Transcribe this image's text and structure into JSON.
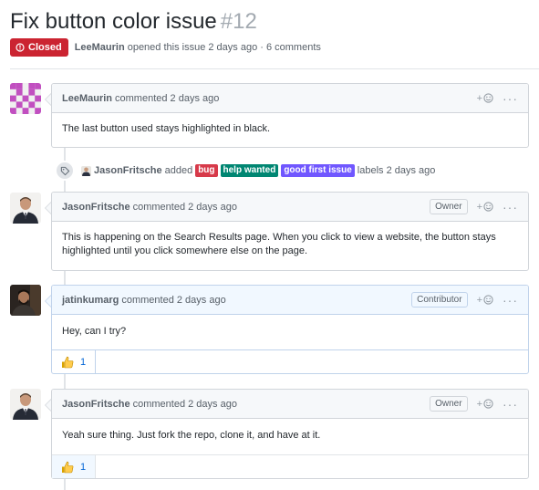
{
  "issue": {
    "title": "Fix button color issue",
    "number": "#12",
    "state": "Closed",
    "author": "LeeMaurin",
    "meta_text": "opened this issue 2 days ago · 6 comments"
  },
  "colors": {
    "closed": "#cb2431",
    "bug": "#d73a4a",
    "help_wanted": "#008672",
    "good_first_issue": "#7057ff",
    "link": "#0366d6"
  },
  "comments": [
    {
      "author": "LeeMaurin",
      "time": "commented 2 days ago",
      "body": "The last button used stays highlighted in black.",
      "react_plus": "+"
    },
    {
      "author": "JasonFritsche",
      "time": "commented 2 days ago",
      "role": "Owner",
      "body": "This is happening on the Search Results page. When you click to view a website, the button stays highlighted until you click somewhere else on the page.",
      "react_plus": "+"
    },
    {
      "author": "jatinkumarg",
      "time": "commented 2 days ago",
      "role": "Contributor",
      "body": "Hey, can I try?",
      "react_plus": "+",
      "reaction": {
        "icon": "thumbs-up-icon",
        "count": "1"
      }
    },
    {
      "author": "JasonFritsche",
      "time": "commented 2 days ago",
      "role": "Owner",
      "body": "Yeah sure thing. Just fork the repo, clone it, and have at it.",
      "react_plus": "+",
      "reaction": {
        "icon": "thumbs-up-icon",
        "count": "1"
      }
    }
  ],
  "label_event": {
    "actor": "JasonFritsche",
    "verb": "added",
    "labels": [
      "bug",
      "help wanted",
      "good first issue"
    ],
    "suffix": "labels 2 days ago"
  },
  "more_glyph": "···"
}
